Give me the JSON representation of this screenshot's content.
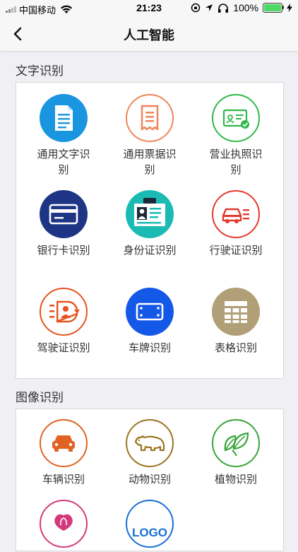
{
  "status": {
    "carrier": "中国移动",
    "time": "21:23",
    "battery": "100%"
  },
  "nav": {
    "title": "人工智能"
  },
  "sections": [
    {
      "title": "文字识别",
      "items": [
        {
          "label": "通用文字识别",
          "icon": "document-icon"
        },
        {
          "label": "通用票据识别",
          "icon": "receipt-icon"
        },
        {
          "label": "营业执照识别",
          "icon": "business-license-icon"
        },
        {
          "label": "银行卡识别",
          "icon": "bank-card-icon"
        },
        {
          "label": "身份证识别",
          "icon": "id-card-icon"
        },
        {
          "label": "行驶证识别",
          "icon": "vehicle-license-icon"
        },
        {
          "label": "驾驶证识别",
          "icon": "driver-license-icon"
        },
        {
          "label": "车牌识别",
          "icon": "license-plate-icon"
        },
        {
          "label": "表格识别",
          "icon": "table-icon"
        }
      ]
    },
    {
      "title": "图像识别",
      "items": [
        {
          "label": "车辆识别",
          "icon": "car-icon"
        },
        {
          "label": "动物识别",
          "icon": "animal-icon"
        },
        {
          "label": "植物识别",
          "icon": "plant-icon"
        },
        {
          "label": "",
          "icon": "flower-icon"
        },
        {
          "label": "LOGO",
          "icon": "logo-icon"
        }
      ]
    }
  ]
}
